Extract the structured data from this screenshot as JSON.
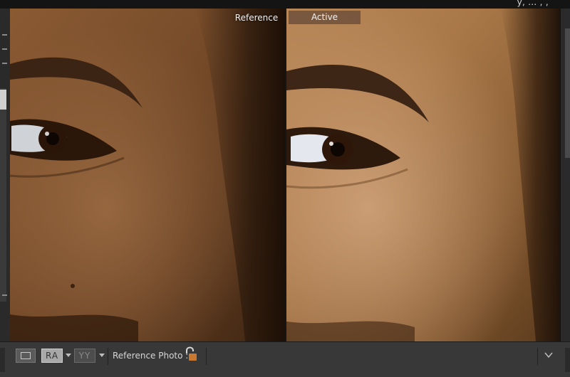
{
  "window": {
    "menu_fragment": "y, ... , ,"
  },
  "compare_view": {
    "reference_label": "Reference",
    "active_label": "Active"
  },
  "toolbar": {
    "loupe_icon": "loupe-view-icon",
    "reference_active_button_label": "RA",
    "side_by_side_button_label": "YY",
    "reference_photo_label": "Reference Photo :",
    "lock_icon": "unlocked-padlock-icon",
    "expand_icon": "chevron-down-icon"
  },
  "colors": {
    "active_label_bg": "#6e503c",
    "lock_body": "#c8782f",
    "toolbar_bg": "#383838"
  }
}
